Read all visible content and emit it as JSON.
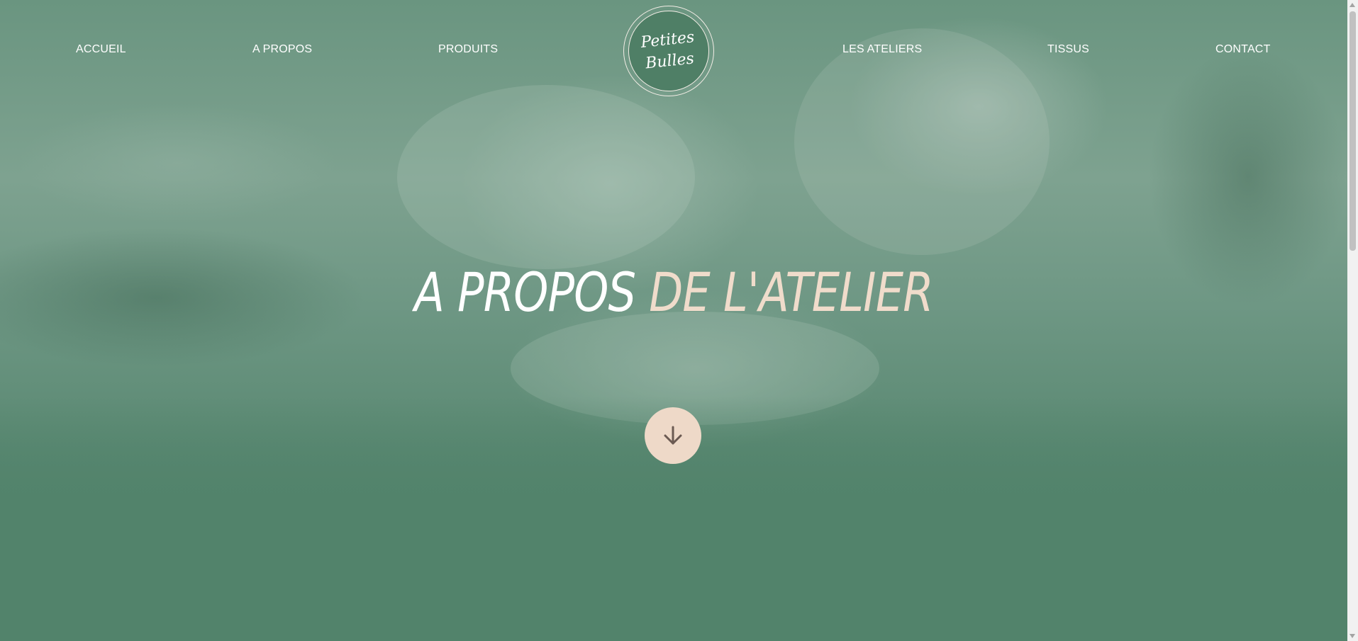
{
  "nav": {
    "left_items": [
      {
        "label": "ACCUEIL"
      },
      {
        "label": "A PROPOS"
      },
      {
        "label": "PRODUITS"
      }
    ],
    "right_items": [
      {
        "label": "LES ATELIERS"
      },
      {
        "label": "TISSUS"
      },
      {
        "label": "CONTACT"
      }
    ],
    "logo": {
      "line1": "Petites",
      "line2": "Bulles"
    }
  },
  "hero": {
    "title_part1": "A PROPOS",
    "title_part2": "DE L'ATELIER",
    "scroll_icon": "arrow-down-icon"
  },
  "colors": {
    "brand_green": "#52836b",
    "accent_beige": "#eed9c8",
    "text_white": "#ffffff"
  }
}
